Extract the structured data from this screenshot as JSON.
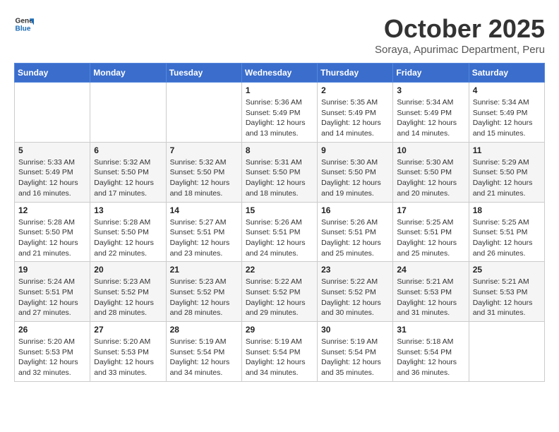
{
  "logo": {
    "line1": "General",
    "line2": "Blue"
  },
  "title": "October 2025",
  "subtitle": "Soraya, Apurimac Department, Peru",
  "weekdays": [
    "Sunday",
    "Monday",
    "Tuesday",
    "Wednesday",
    "Thursday",
    "Friday",
    "Saturday"
  ],
  "weeks": [
    [
      {
        "day": "",
        "info": ""
      },
      {
        "day": "",
        "info": ""
      },
      {
        "day": "",
        "info": ""
      },
      {
        "day": "1",
        "info": "Sunrise: 5:36 AM\nSunset: 5:49 PM\nDaylight: 12 hours\nand 13 minutes."
      },
      {
        "day": "2",
        "info": "Sunrise: 5:35 AM\nSunset: 5:49 PM\nDaylight: 12 hours\nand 14 minutes."
      },
      {
        "day": "3",
        "info": "Sunrise: 5:34 AM\nSunset: 5:49 PM\nDaylight: 12 hours\nand 14 minutes."
      },
      {
        "day": "4",
        "info": "Sunrise: 5:34 AM\nSunset: 5:49 PM\nDaylight: 12 hours\nand 15 minutes."
      }
    ],
    [
      {
        "day": "5",
        "info": "Sunrise: 5:33 AM\nSunset: 5:49 PM\nDaylight: 12 hours\nand 16 minutes."
      },
      {
        "day": "6",
        "info": "Sunrise: 5:32 AM\nSunset: 5:50 PM\nDaylight: 12 hours\nand 17 minutes."
      },
      {
        "day": "7",
        "info": "Sunrise: 5:32 AM\nSunset: 5:50 PM\nDaylight: 12 hours\nand 18 minutes."
      },
      {
        "day": "8",
        "info": "Sunrise: 5:31 AM\nSunset: 5:50 PM\nDaylight: 12 hours\nand 18 minutes."
      },
      {
        "day": "9",
        "info": "Sunrise: 5:30 AM\nSunset: 5:50 PM\nDaylight: 12 hours\nand 19 minutes."
      },
      {
        "day": "10",
        "info": "Sunrise: 5:30 AM\nSunset: 5:50 PM\nDaylight: 12 hours\nand 20 minutes."
      },
      {
        "day": "11",
        "info": "Sunrise: 5:29 AM\nSunset: 5:50 PM\nDaylight: 12 hours\nand 21 minutes."
      }
    ],
    [
      {
        "day": "12",
        "info": "Sunrise: 5:28 AM\nSunset: 5:50 PM\nDaylight: 12 hours\nand 21 minutes."
      },
      {
        "day": "13",
        "info": "Sunrise: 5:28 AM\nSunset: 5:50 PM\nDaylight: 12 hours\nand 22 minutes."
      },
      {
        "day": "14",
        "info": "Sunrise: 5:27 AM\nSunset: 5:51 PM\nDaylight: 12 hours\nand 23 minutes."
      },
      {
        "day": "15",
        "info": "Sunrise: 5:26 AM\nSunset: 5:51 PM\nDaylight: 12 hours\nand 24 minutes."
      },
      {
        "day": "16",
        "info": "Sunrise: 5:26 AM\nSunset: 5:51 PM\nDaylight: 12 hours\nand 25 minutes."
      },
      {
        "day": "17",
        "info": "Sunrise: 5:25 AM\nSunset: 5:51 PM\nDaylight: 12 hours\nand 25 minutes."
      },
      {
        "day": "18",
        "info": "Sunrise: 5:25 AM\nSunset: 5:51 PM\nDaylight: 12 hours\nand 26 minutes."
      }
    ],
    [
      {
        "day": "19",
        "info": "Sunrise: 5:24 AM\nSunset: 5:51 PM\nDaylight: 12 hours\nand 27 minutes."
      },
      {
        "day": "20",
        "info": "Sunrise: 5:23 AM\nSunset: 5:52 PM\nDaylight: 12 hours\nand 28 minutes."
      },
      {
        "day": "21",
        "info": "Sunrise: 5:23 AM\nSunset: 5:52 PM\nDaylight: 12 hours\nand 28 minutes."
      },
      {
        "day": "22",
        "info": "Sunrise: 5:22 AM\nSunset: 5:52 PM\nDaylight: 12 hours\nand 29 minutes."
      },
      {
        "day": "23",
        "info": "Sunrise: 5:22 AM\nSunset: 5:52 PM\nDaylight: 12 hours\nand 30 minutes."
      },
      {
        "day": "24",
        "info": "Sunrise: 5:21 AM\nSunset: 5:53 PM\nDaylight: 12 hours\nand 31 minutes."
      },
      {
        "day": "25",
        "info": "Sunrise: 5:21 AM\nSunset: 5:53 PM\nDaylight: 12 hours\nand 31 minutes."
      }
    ],
    [
      {
        "day": "26",
        "info": "Sunrise: 5:20 AM\nSunset: 5:53 PM\nDaylight: 12 hours\nand 32 minutes."
      },
      {
        "day": "27",
        "info": "Sunrise: 5:20 AM\nSunset: 5:53 PM\nDaylight: 12 hours\nand 33 minutes."
      },
      {
        "day": "28",
        "info": "Sunrise: 5:19 AM\nSunset: 5:54 PM\nDaylight: 12 hours\nand 34 minutes."
      },
      {
        "day": "29",
        "info": "Sunrise: 5:19 AM\nSunset: 5:54 PM\nDaylight: 12 hours\nand 34 minutes."
      },
      {
        "day": "30",
        "info": "Sunrise: 5:19 AM\nSunset: 5:54 PM\nDaylight: 12 hours\nand 35 minutes."
      },
      {
        "day": "31",
        "info": "Sunrise: 5:18 AM\nSunset: 5:54 PM\nDaylight: 12 hours\nand 36 minutes."
      },
      {
        "day": "",
        "info": ""
      }
    ]
  ]
}
